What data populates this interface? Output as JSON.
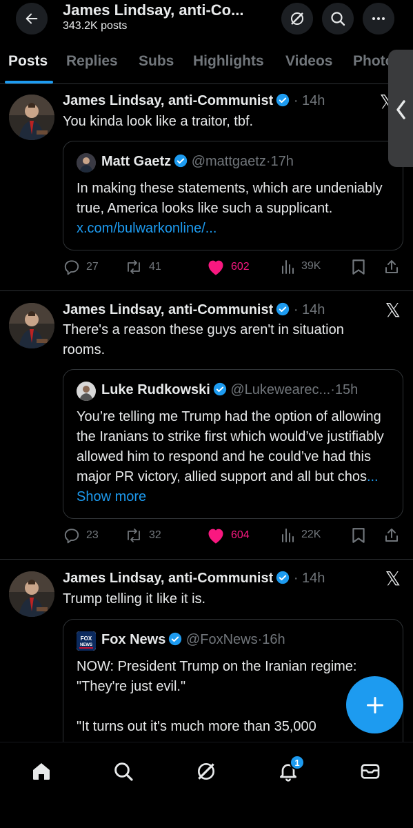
{
  "header": {
    "title": "James Lindsay, anti-Co...",
    "post_count": "343.2K posts"
  },
  "tabs": [
    {
      "label": "Posts",
      "active": true
    },
    {
      "label": "Replies"
    },
    {
      "label": "Subs"
    },
    {
      "label": "Highlights"
    },
    {
      "label": "Videos"
    },
    {
      "label": "Photos"
    }
  ],
  "posts": [
    {
      "author": "James Lindsay, anti-Communist",
      "time": "14h",
      "text": "You kinda look like a traitor, tbf.",
      "quote": {
        "author": "Matt Gaetz",
        "handle": "@mattgaetz",
        "time": "17h",
        "text": "In making these statements, which are undeniably true, America looks like such a supplicant. ",
        "link": "x.com/bulwarkonline/..."
      },
      "stats": {
        "replies": "27",
        "reposts": "41",
        "likes": "602",
        "views": "39K"
      }
    },
    {
      "author": "James Lindsay, anti-Communist",
      "time": "14h",
      "text": "There's a reason these guys aren't in situation rooms.",
      "quote": {
        "author": "Luke Rudkowski",
        "handle": "@Lukewearec...",
        "time": "15h",
        "text": "You’re telling me Trump had the option of allowing the Iranians to strike first which would’ve justifiably allowed him to respond and he could’ve had this major PR victory, allied support and all but chos",
        "link": "... Show more"
      },
      "stats": {
        "replies": "23",
        "reposts": "32",
        "likes": "604",
        "views": "22K"
      }
    },
    {
      "author": "James Lindsay, anti-Communist",
      "time": "14h",
      "text": "Trump telling it like it is.",
      "quote": {
        "author": "Fox News",
        "handle": "@FoxNews",
        "time": "16h",
        "text1": "NOW: President Trump on the Iranian regime: \"They're just evil.\"",
        "text2": "\"It turns out it's much more than 35,000",
        "logo_text": "FOX NEWS"
      }
    }
  ],
  "nav": {
    "notification_count": "1"
  },
  "colors": {
    "accent": "#1d9bf0",
    "like": "#f91880",
    "muted": "#71767b",
    "border": "#2f3336"
  }
}
